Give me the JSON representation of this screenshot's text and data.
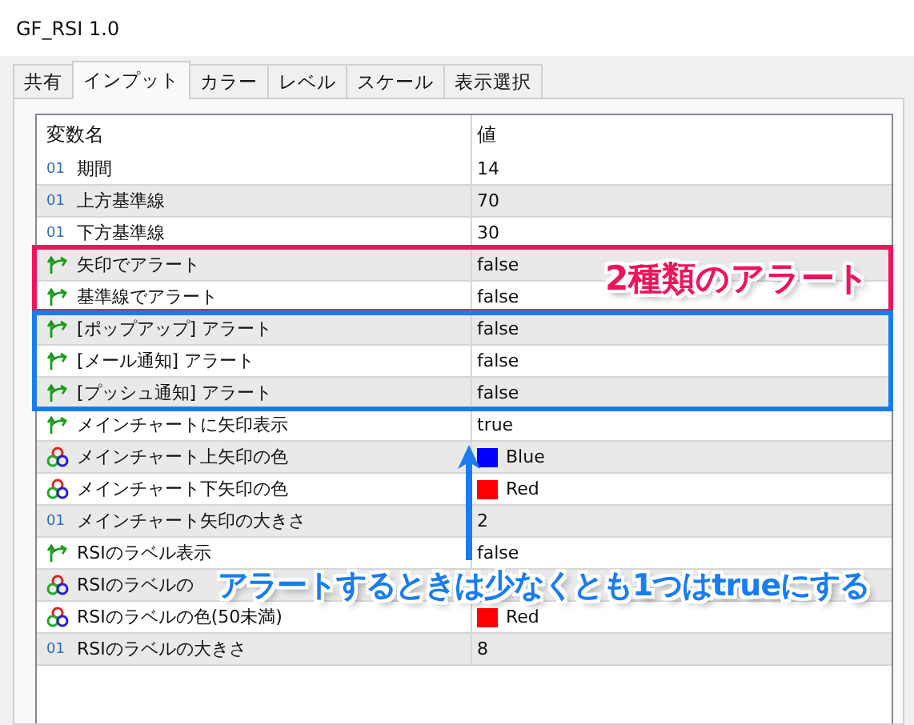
{
  "window": {
    "title": "GF_RSI 1.0"
  },
  "tabs": [
    {
      "label": "共有",
      "selected": false
    },
    {
      "label": "インプット",
      "selected": true
    },
    {
      "label": "カラー",
      "selected": false
    },
    {
      "label": "レベル",
      "selected": false
    },
    {
      "label": "スケール",
      "selected": false
    },
    {
      "label": "表示選択",
      "selected": false
    }
  ],
  "table": {
    "columns": [
      "変数名",
      "値"
    ],
    "rows": [
      {
        "kind": "int",
        "badge": "01",
        "name": "期間",
        "value": "14"
      },
      {
        "kind": "int",
        "badge": "01",
        "name": "上方基準線",
        "value": "70"
      },
      {
        "kind": "int",
        "badge": "01",
        "name": "下方基準線",
        "value": "30"
      },
      {
        "kind": "bool",
        "name": "矢印でアラート",
        "value": "false"
      },
      {
        "kind": "bool",
        "name": "基準線でアラート",
        "value": "false"
      },
      {
        "kind": "bool",
        "name": "[ポップアップ] アラート",
        "value": "false"
      },
      {
        "kind": "bool",
        "name": "[メール通知] アラート",
        "value": "false"
      },
      {
        "kind": "bool",
        "name": "[プッシュ通知] アラート",
        "value": "false"
      },
      {
        "kind": "bool",
        "name": "メインチャートに矢印表示",
        "value": "true"
      },
      {
        "kind": "color",
        "name": "メインチャート上矢印の色",
        "value": "Blue",
        "color": "#0000ff"
      },
      {
        "kind": "color",
        "name": "メインチャート下矢印の色",
        "value": "Red",
        "color": "#ff0000"
      },
      {
        "kind": "int",
        "badge": "01",
        "name": "メインチャート矢印の大きさ",
        "value": "2"
      },
      {
        "kind": "bool",
        "name": "RSIのラベル表示",
        "value": "false"
      },
      {
        "kind": "color",
        "name": "RSIのラベルの"
      },
      {
        "kind": "color",
        "name": "RSIのラベルの色(50未満)",
        "value": "Red",
        "color": "#ff0000"
      },
      {
        "kind": "int",
        "badge": "01",
        "name": "RSIのラベルの大きさ",
        "value": "8"
      }
    ]
  },
  "callouts": [
    {
      "kind": "frame",
      "color": "#f0145a",
      "label": "2種類のアラート"
    },
    {
      "kind": "frame",
      "color": "#1a7cf0"
    },
    {
      "kind": "arrow-note",
      "color": "#1a7cf0",
      "label": "アラートするときは少なくとも1つはtrueにする"
    }
  ]
}
